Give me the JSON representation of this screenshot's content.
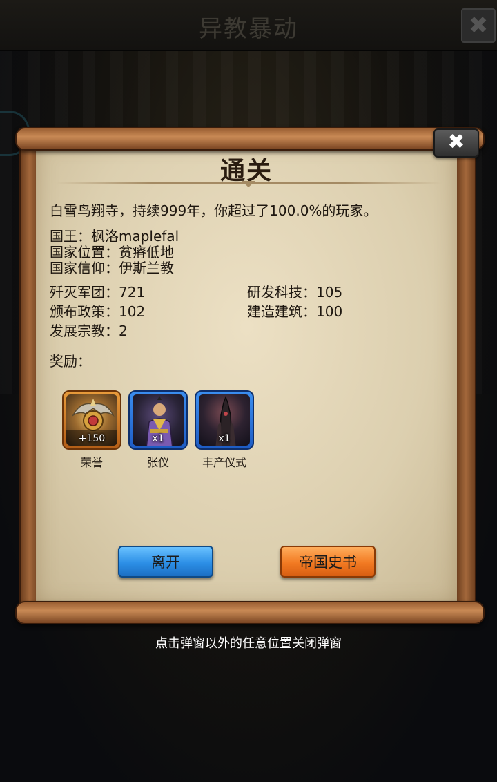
{
  "background": {
    "title": "异教暴动"
  },
  "dialog": {
    "title": "通关",
    "summary": "白雪鸟翔寺，持续999年，你超过了100.0%的玩家。",
    "king": "国王：枫洛maplefal",
    "location": "国家位置：贫瘠低地",
    "religion": "国家信仰：伊斯兰教",
    "stats": {
      "armies": "歼灭军团：721",
      "policies": "颁布政策：102",
      "religions": "发展宗教：2",
      "tech": "研发科技：105",
      "buildings": "建造建筑：100"
    },
    "rewards_label": "奖励：",
    "rewards": [
      {
        "name": "荣誉",
        "count": "+150"
      },
      {
        "name": "张仪",
        "count": "x1"
      },
      {
        "name": "丰产仪式",
        "count": "x1"
      }
    ],
    "leave_label": "离开",
    "history_label": "帝国史书",
    "close_icon": "✖"
  },
  "hint": "点击弹窗以外的任意位置关闭弹窗",
  "colors": {
    "leave_button": "#2c8fe6",
    "history_button": "#f27a22",
    "paper": "#e4d6b8"
  }
}
